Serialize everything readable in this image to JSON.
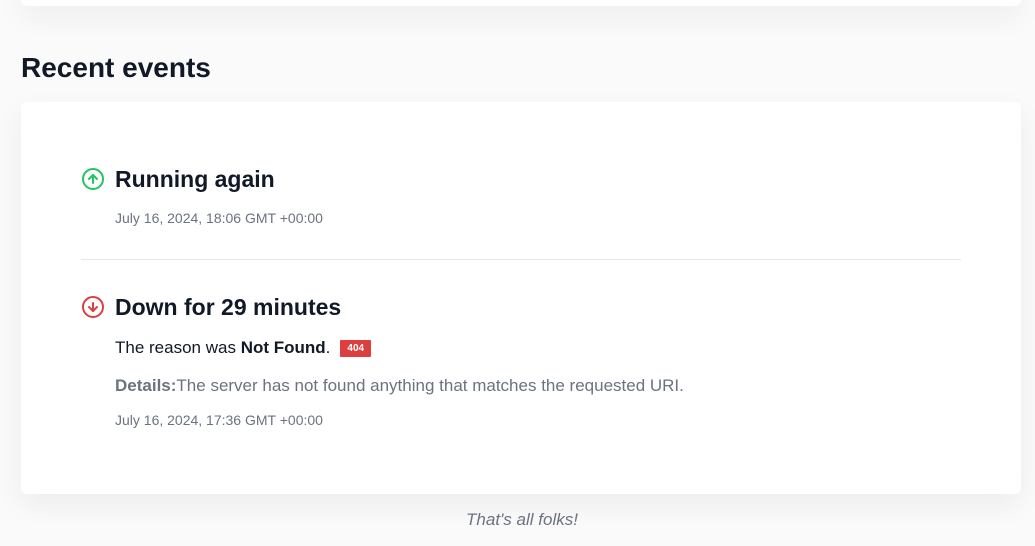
{
  "section": {
    "title": "Recent events"
  },
  "events": [
    {
      "status": "up",
      "icon": "arrow-up-circle-icon",
      "color": "#22c55e",
      "title": "Running again",
      "timestamp": "July 16, 2024, 18:06 GMT +00:00"
    },
    {
      "status": "down",
      "icon": "arrow-down-circle-icon",
      "color": "#dc3f3f",
      "title": "Down for 29 minutes",
      "reason_prefix": "The reason was ",
      "reason": "Not Found",
      "reason_suffix": ".",
      "code": "404",
      "details_label": "Details:",
      "details_text": "The server has not found anything that matches the requested URI.",
      "timestamp": "July 16, 2024, 17:36 GMT +00:00"
    }
  ],
  "footer": {
    "note": "That's all folks!"
  }
}
